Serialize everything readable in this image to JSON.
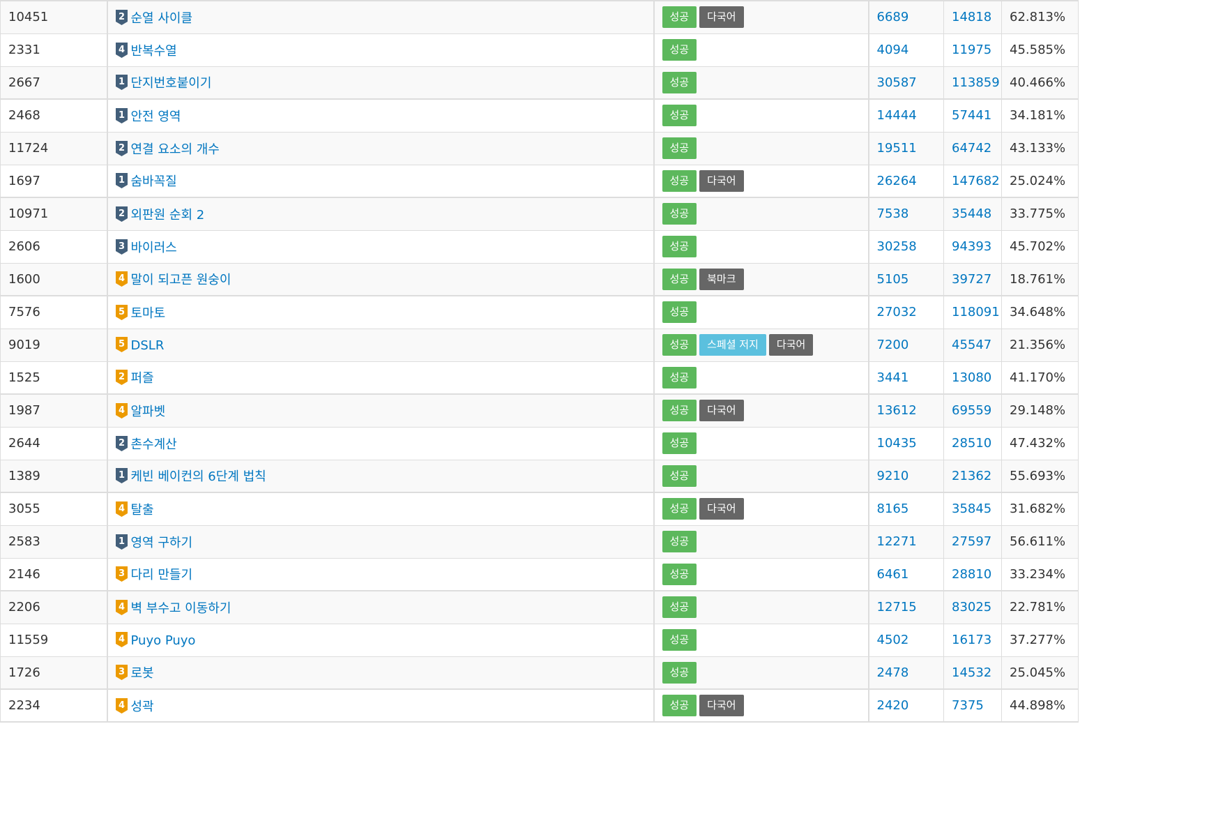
{
  "colors": {
    "link": "#0076c0",
    "success": "#5cb85c",
    "dark": "#666666",
    "info": "#5bc0de",
    "tier_silver": "#435f7a",
    "tier_gold": "#ec9a00"
  },
  "rows": [
    {
      "id": "10451",
      "tier": "silver",
      "level": "2",
      "title": "순열 사이클",
      "labels": [
        {
          "text": "성공",
          "kind": "success"
        },
        {
          "text": "다국어",
          "kind": "dark"
        }
      ],
      "solved": "6689",
      "submissions": "14818",
      "ratio": "62.813%"
    },
    {
      "id": "2331",
      "tier": "silver",
      "level": "4",
      "title": "반복수열",
      "labels": [
        {
          "text": "성공",
          "kind": "success"
        }
      ],
      "solved": "4094",
      "submissions": "11975",
      "ratio": "45.585%"
    },
    {
      "id": "2667",
      "tier": "silver",
      "level": "1",
      "title": "단지번호붙이기",
      "labels": [
        {
          "text": "성공",
          "kind": "success"
        }
      ],
      "solved": "30587",
      "submissions": "113859",
      "ratio": "40.466%"
    },
    {
      "id": "2468",
      "tier": "silver",
      "level": "1",
      "title": "안전 영역",
      "labels": [
        {
          "text": "성공",
          "kind": "success"
        }
      ],
      "solved": "14444",
      "submissions": "57441",
      "ratio": "34.181%"
    },
    {
      "id": "11724",
      "tier": "silver",
      "level": "2",
      "title": "연결 요소의 개수",
      "labels": [
        {
          "text": "성공",
          "kind": "success"
        }
      ],
      "solved": "19511",
      "submissions": "64742",
      "ratio": "43.133%"
    },
    {
      "id": "1697",
      "tier": "silver",
      "level": "1",
      "title": "숨바꼭질",
      "labels": [
        {
          "text": "성공",
          "kind": "success"
        },
        {
          "text": "다국어",
          "kind": "dark"
        }
      ],
      "solved": "26264",
      "submissions": "147682",
      "ratio": "25.024%"
    },
    {
      "id": "10971",
      "tier": "silver",
      "level": "2",
      "title": "외판원 순회 2",
      "labels": [
        {
          "text": "성공",
          "kind": "success"
        }
      ],
      "solved": "7538",
      "submissions": "35448",
      "ratio": "33.775%"
    },
    {
      "id": "2606",
      "tier": "silver",
      "level": "3",
      "title": "바이러스",
      "labels": [
        {
          "text": "성공",
          "kind": "success"
        }
      ],
      "solved": "30258",
      "submissions": "94393",
      "ratio": "45.702%"
    },
    {
      "id": "1600",
      "tier": "gold",
      "level": "4",
      "title": "말이 되고픈 원숭이",
      "labels": [
        {
          "text": "성공",
          "kind": "success"
        },
        {
          "text": "북마크",
          "kind": "dark"
        }
      ],
      "solved": "5105",
      "submissions": "39727",
      "ratio": "18.761%"
    },
    {
      "id": "7576",
      "tier": "gold",
      "level": "5",
      "title": "토마토",
      "labels": [
        {
          "text": "성공",
          "kind": "success"
        }
      ],
      "solved": "27032",
      "submissions": "118091",
      "ratio": "34.648%"
    },
    {
      "id": "9019",
      "tier": "gold",
      "level": "5",
      "title": "DSLR",
      "labels": [
        {
          "text": "성공",
          "kind": "success"
        },
        {
          "text": "스페셜 저지",
          "kind": "info"
        },
        {
          "text": "다국어",
          "kind": "dark"
        }
      ],
      "solved": "7200",
      "submissions": "45547",
      "ratio": "21.356%"
    },
    {
      "id": "1525",
      "tier": "gold",
      "level": "2",
      "title": "퍼즐",
      "labels": [
        {
          "text": "성공",
          "kind": "success"
        }
      ],
      "solved": "3441",
      "submissions": "13080",
      "ratio": "41.170%"
    },
    {
      "id": "1987",
      "tier": "gold",
      "level": "4",
      "title": "알파벳",
      "labels": [
        {
          "text": "성공",
          "kind": "success"
        },
        {
          "text": "다국어",
          "kind": "dark"
        }
      ],
      "solved": "13612",
      "submissions": "69559",
      "ratio": "29.148%"
    },
    {
      "id": "2644",
      "tier": "silver",
      "level": "2",
      "title": "촌수계산",
      "labels": [
        {
          "text": "성공",
          "kind": "success"
        }
      ],
      "solved": "10435",
      "submissions": "28510",
      "ratio": "47.432%"
    },
    {
      "id": "1389",
      "tier": "silver",
      "level": "1",
      "title": "케빈 베이컨의 6단계 법칙",
      "labels": [
        {
          "text": "성공",
          "kind": "success"
        }
      ],
      "solved": "9210",
      "submissions": "21362",
      "ratio": "55.693%"
    },
    {
      "id": "3055",
      "tier": "gold",
      "level": "4",
      "title": "탈출",
      "labels": [
        {
          "text": "성공",
          "kind": "success"
        },
        {
          "text": "다국어",
          "kind": "dark"
        }
      ],
      "solved": "8165",
      "submissions": "35845",
      "ratio": "31.682%"
    },
    {
      "id": "2583",
      "tier": "silver",
      "level": "1",
      "title": "영역 구하기",
      "labels": [
        {
          "text": "성공",
          "kind": "success"
        }
      ],
      "solved": "12271",
      "submissions": "27597",
      "ratio": "56.611%"
    },
    {
      "id": "2146",
      "tier": "gold",
      "level": "3",
      "title": "다리 만들기",
      "labels": [
        {
          "text": "성공",
          "kind": "success"
        }
      ],
      "solved": "6461",
      "submissions": "28810",
      "ratio": "33.234%"
    },
    {
      "id": "2206",
      "tier": "gold",
      "level": "4",
      "title": "벽 부수고 이동하기",
      "labels": [
        {
          "text": "성공",
          "kind": "success"
        }
      ],
      "solved": "12715",
      "submissions": "83025",
      "ratio": "22.781%"
    },
    {
      "id": "11559",
      "tier": "gold",
      "level": "4",
      "title": "Puyo Puyo",
      "labels": [
        {
          "text": "성공",
          "kind": "success"
        }
      ],
      "solved": "4502",
      "submissions": "16173",
      "ratio": "37.277%"
    },
    {
      "id": "1726",
      "tier": "gold",
      "level": "3",
      "title": "로봇",
      "labels": [
        {
          "text": "성공",
          "kind": "success"
        }
      ],
      "solved": "2478",
      "submissions": "14532",
      "ratio": "25.045%"
    },
    {
      "id": "2234",
      "tier": "gold",
      "level": "4",
      "title": "성곽",
      "labels": [
        {
          "text": "성공",
          "kind": "success"
        },
        {
          "text": "다국어",
          "kind": "dark"
        }
      ],
      "solved": "2420",
      "submissions": "7375",
      "ratio": "44.898%"
    }
  ]
}
